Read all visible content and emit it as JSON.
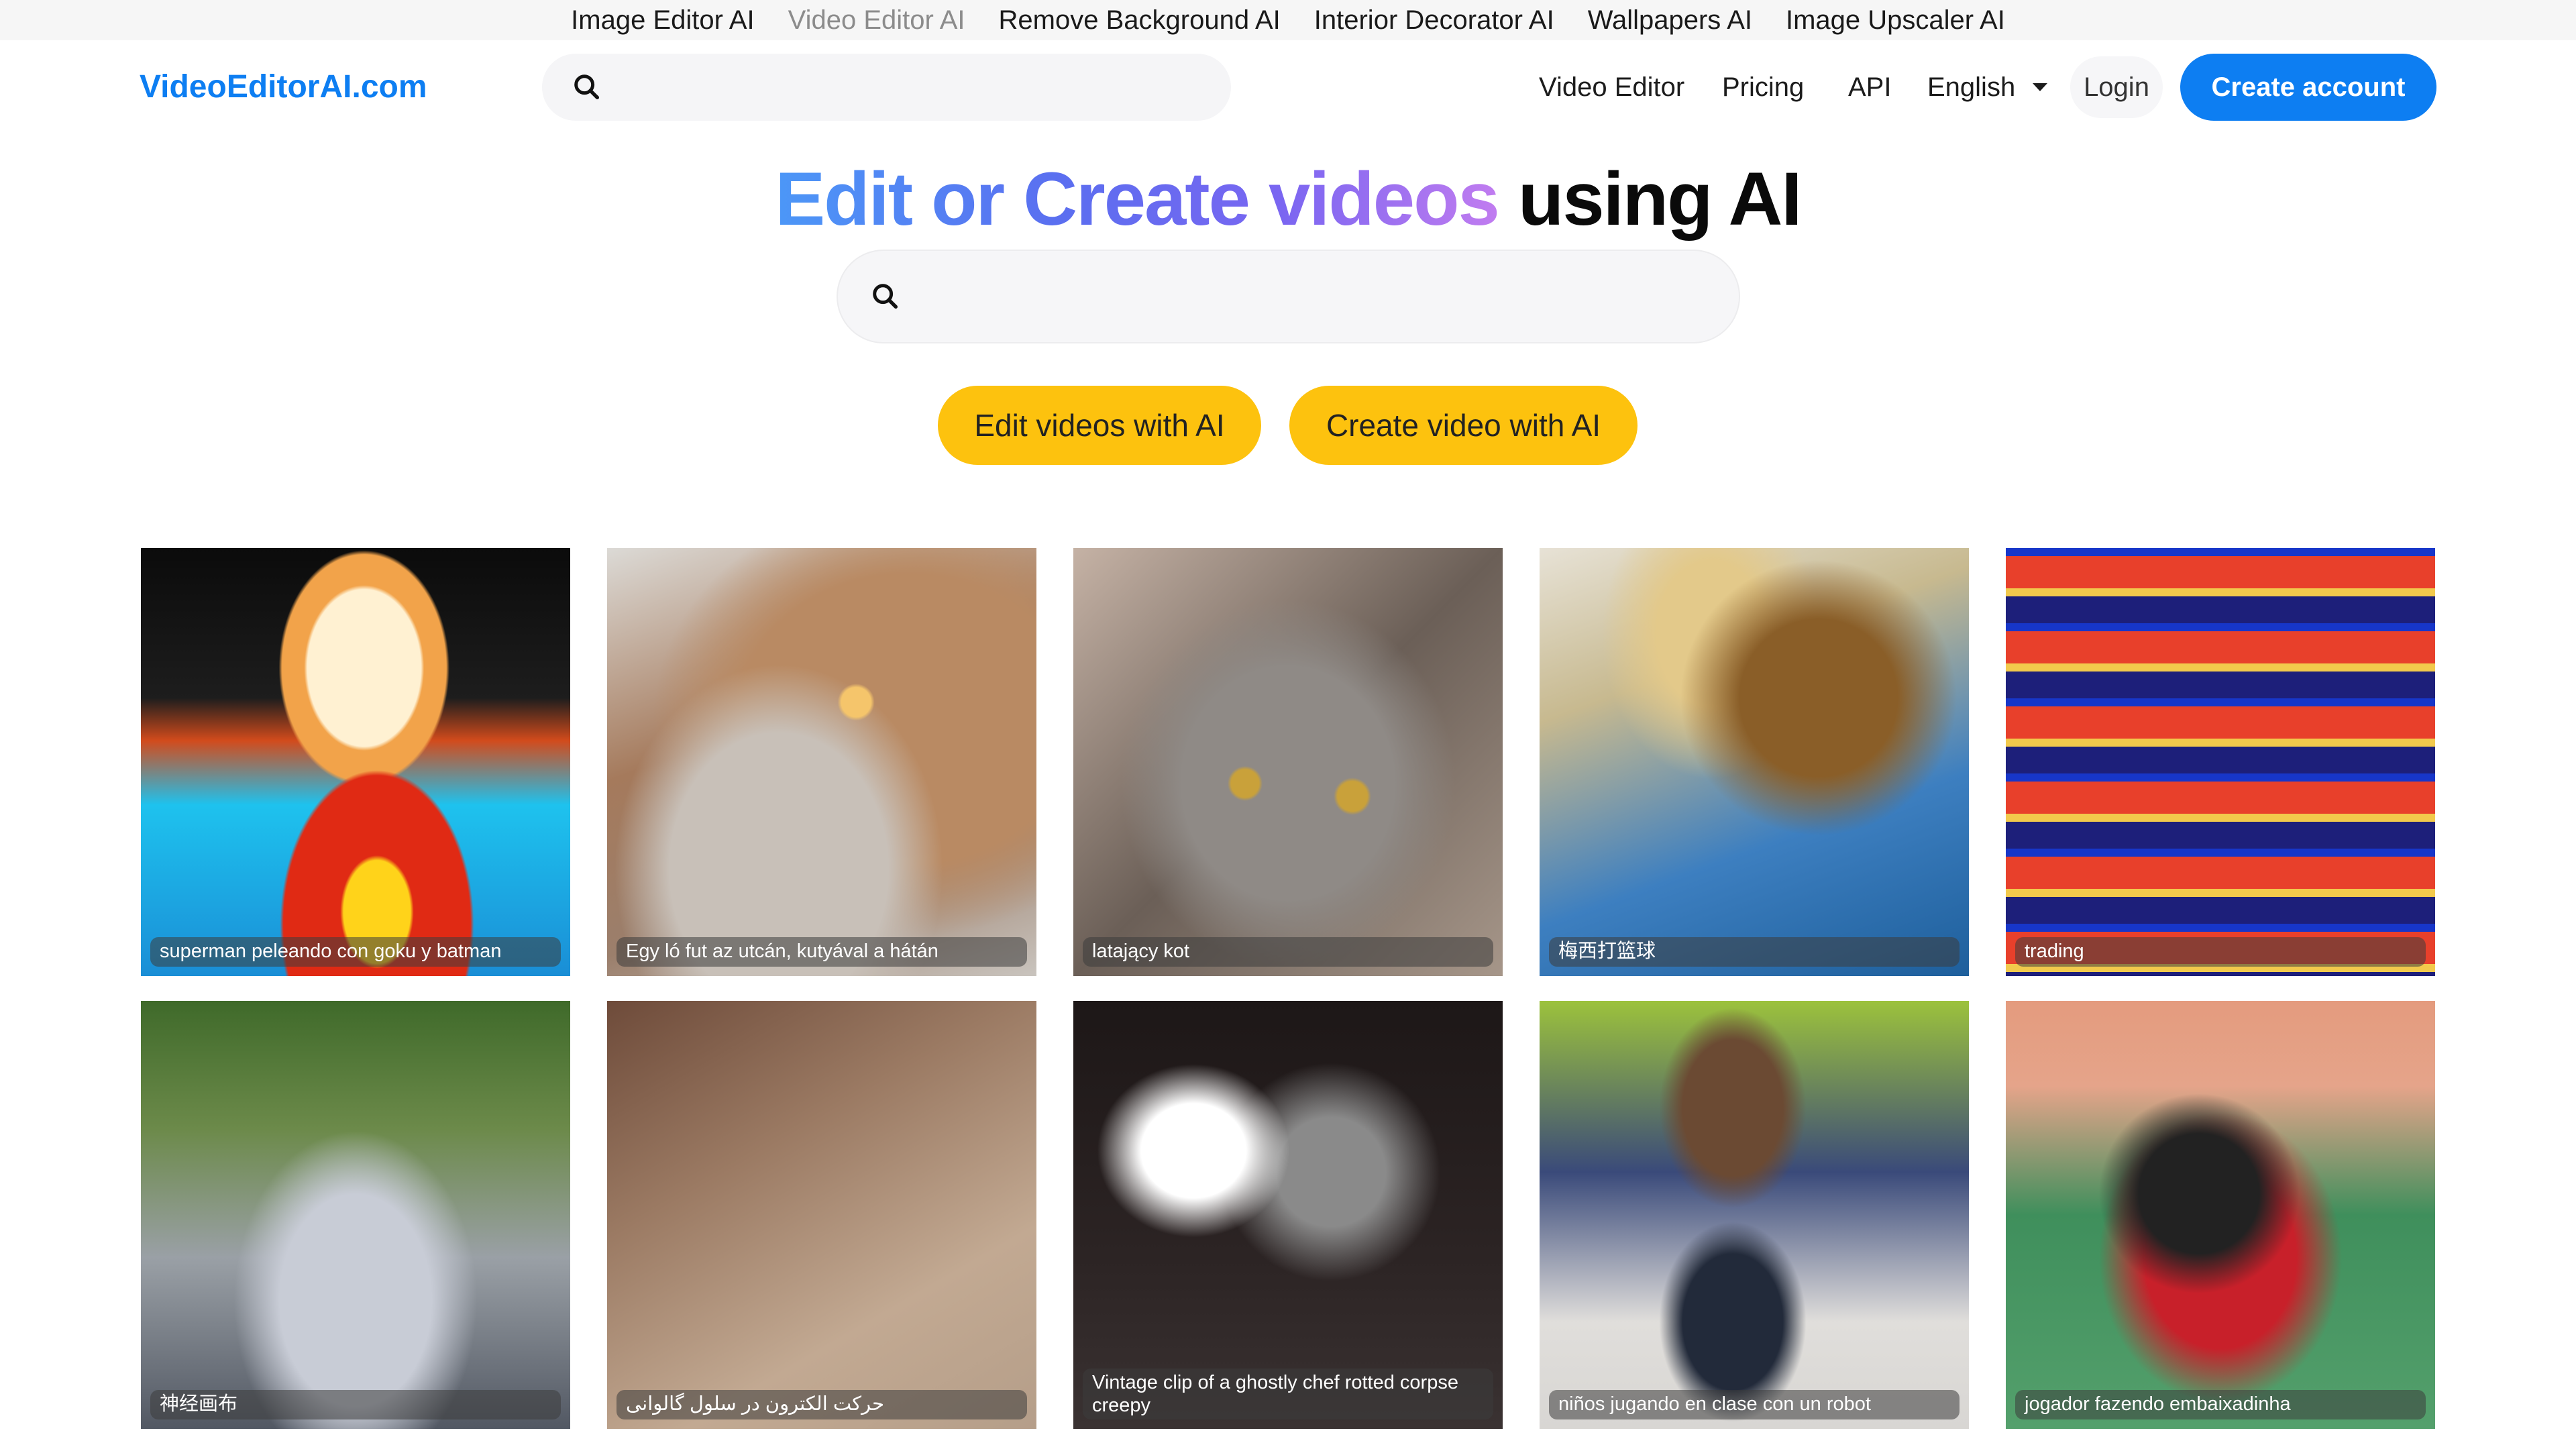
{
  "topbar": {
    "links": [
      {
        "label": "Image Editor AI",
        "active": false
      },
      {
        "label": "Video Editor AI",
        "active": true
      },
      {
        "label": "Remove Background AI",
        "active": false
      },
      {
        "label": "Interior Decorator AI",
        "active": false
      },
      {
        "label": "Wallpapers AI",
        "active": false
      },
      {
        "label": "Image Upscaler AI",
        "active": false
      }
    ]
  },
  "header": {
    "logo": "VideoEditorAI.com",
    "search_placeholder": "",
    "search_value": "",
    "search_icon": "search-icon",
    "nav": {
      "video_editor": "Video Editor",
      "pricing": "Pricing",
      "api": "API",
      "language": "English",
      "language_icon": "caret-down-icon"
    },
    "login": "Login",
    "create_account": "Create account"
  },
  "hero": {
    "title_gradient": "Edit or Create videos",
    "title_plain": "using AI",
    "search_placeholder": "",
    "search_value": "",
    "search_icon": "search-icon",
    "buttons": {
      "edit": "Edit videos with AI",
      "create": "Create video with AI"
    }
  },
  "colors": {
    "brand_blue": "#0d7ef2",
    "cta_yellow": "#fdc20e",
    "gradient": [
      "#4c97f7",
      "#5b6ef0",
      "#7a66f1",
      "#c17cf0"
    ]
  },
  "gallery": {
    "items": [
      {
        "caption": "superman peleando con goku y batman"
      },
      {
        "caption": "Egy ló fut az utcán, kutyával a hátán"
      },
      {
        "caption": "latający kot"
      },
      {
        "caption": "梅西打篮球"
      },
      {
        "caption": "trading"
      },
      {
        "caption": "神经画布"
      },
      {
        "caption": "حرکت الکترون در سلول گالوانی"
      },
      {
        "caption": "Vintage clip of a ghostly chef rotted corpse creepy"
      },
      {
        "caption": "niños jugando en clase con un robot"
      },
      {
        "caption": "jogador fazendo embaixadinha"
      }
    ]
  }
}
